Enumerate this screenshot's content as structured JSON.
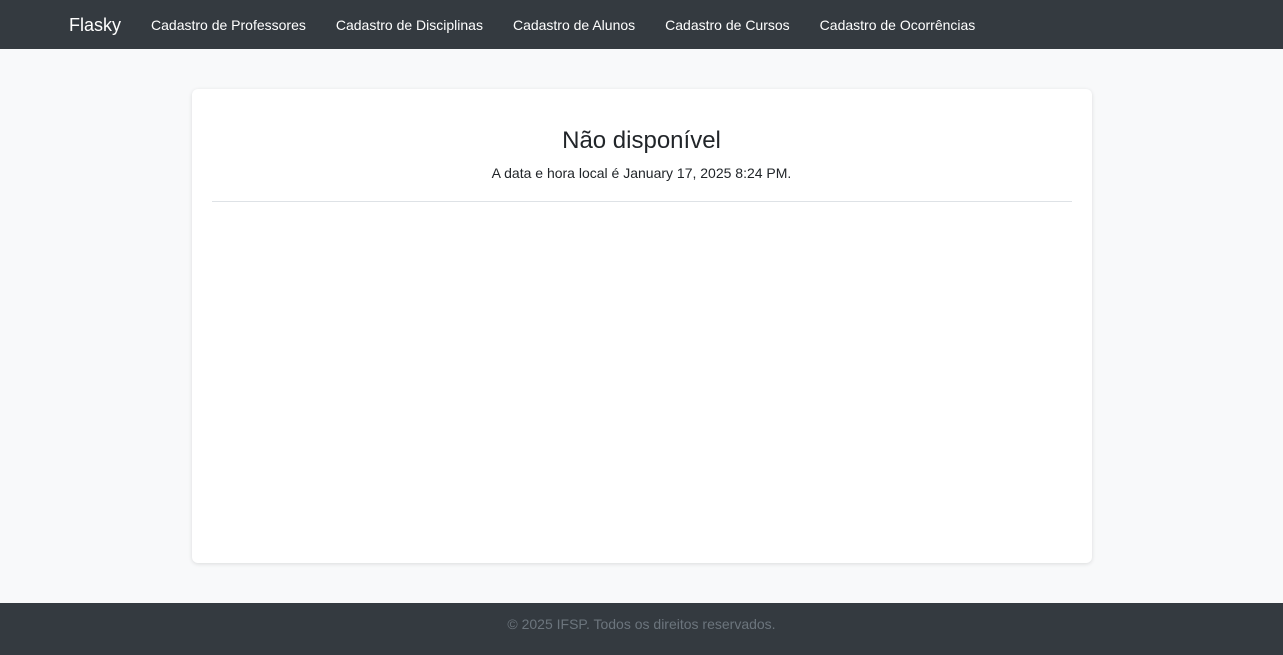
{
  "navbar": {
    "brand": "Flasky",
    "links": [
      "Cadastro de Professores",
      "Cadastro de Disciplinas",
      "Cadastro de Alunos",
      "Cadastro de Cursos",
      "Cadastro de Ocorrências"
    ]
  },
  "main": {
    "title": "Não disponível",
    "subtitle": "A data e hora local é January 17, 2025 8:24 PM."
  },
  "footer": {
    "text": "© 2025 IFSP. Todos os direitos reservados."
  },
  "colors": {
    "navbar_bg": "#343a40",
    "page_bg": "#f8f9fa",
    "card_bg": "#ffffff",
    "footer_text": "#6c757d"
  }
}
